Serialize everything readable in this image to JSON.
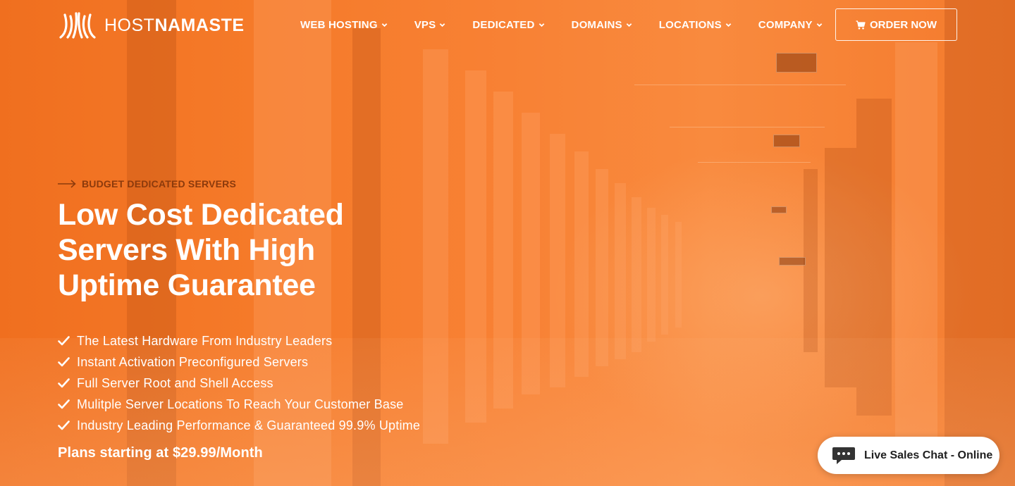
{
  "brand": {
    "name_light": "HOST",
    "name_bold": "NAMASTE",
    "logo_icon": "lotus-hands-logo-icon"
  },
  "nav": {
    "items": [
      {
        "label": "WEB HOSTING"
      },
      {
        "label": "VPS"
      },
      {
        "label": "DEDICATED"
      },
      {
        "label": "DOMAINS"
      },
      {
        "label": "LOCATIONS"
      },
      {
        "label": "COMPANY"
      }
    ],
    "order_label": "ORDER NOW",
    "order_icon": "cart-icon"
  },
  "hero": {
    "eyebrow": "BUDGET DEDICATED SERVERS",
    "headline_lines": [
      "Low Cost Dedicated",
      "Servers With High",
      "Uptime Guarantee"
    ],
    "features": [
      "The Latest Hardware From Industry Leaders",
      "Instant Activation Preconfigured Servers",
      "Full Server Root and Shell Access",
      "Mulitple Server Locations To Reach Your Customer Base",
      "Industry Leading Performance & Guaranteed 99.9% Uptime"
    ],
    "plans": "Plans starting at $29.99/Month"
  },
  "chat": {
    "label": "Live Sales Chat - Online",
    "icon": "chat-bubble-icon"
  },
  "colors": {
    "accent": "#f77a2a",
    "eyebrow": "#8c3a0c",
    "text": "#ffffff"
  }
}
